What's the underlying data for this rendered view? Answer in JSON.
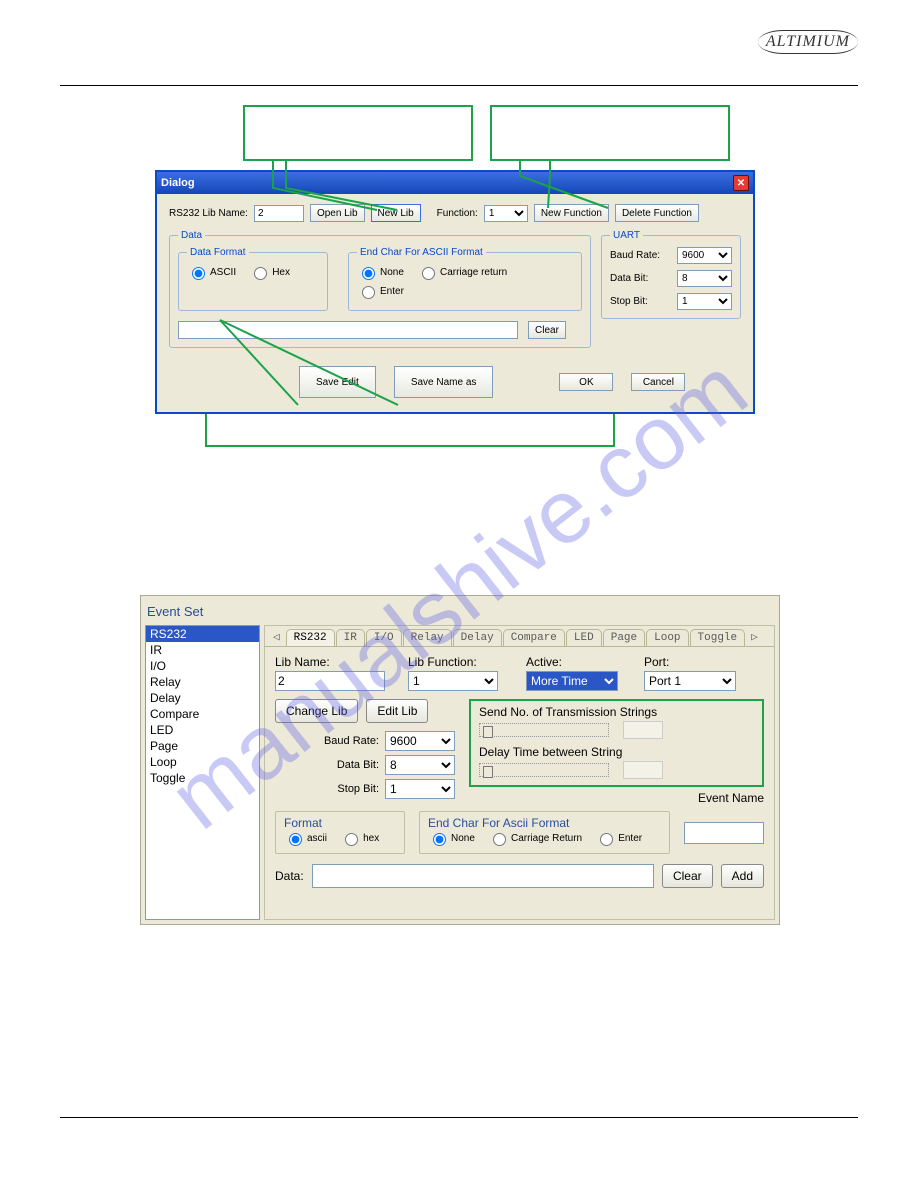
{
  "brand": "ALTIMIUM",
  "watermark": "manualshive.com",
  "dialog": {
    "title": "Dialog",
    "rs232_label": "RS232 Lib Name:",
    "rs232_value": "2",
    "open_lib": "Open Lib",
    "new_lib": "New Lib",
    "function_label": "Function:",
    "function_value": "1",
    "new_function": "New Function",
    "delete_function": "Delete Function",
    "fieldsets": {
      "data": "Data",
      "data_format": "Data Format",
      "end_char": "End Char For ASCII Format",
      "uart": "UART"
    },
    "radios": {
      "ascii": "ASCII",
      "hex": "Hex",
      "none": "None",
      "cr": "Carriage return",
      "enter": "Enter"
    },
    "uart": {
      "baud_label": "Baud Rate:",
      "baud_value": "9600",
      "databit_label": "Data Bit:",
      "databit_value": "8",
      "stopbit_label": "Stop Bit:",
      "stopbit_value": "1"
    },
    "clear": "Clear",
    "save_edit": "Save Edit",
    "save_name_as": "Save Name as",
    "ok": "OK",
    "cancel": "Cancel"
  },
  "eventset": {
    "title": "Event Set",
    "list": [
      "RS232",
      "IR",
      "I/O",
      "Relay",
      "Delay",
      "Compare",
      "LED",
      "Page",
      "Loop",
      "Toggle"
    ],
    "selected": "RS232",
    "tabs": [
      "RS232",
      "IR",
      "I/O",
      "Relay",
      "Delay",
      "Compare",
      "LED",
      "Page",
      "Loop",
      "Toggle"
    ],
    "fields": {
      "lib_name": "Lib Name:",
      "lib_name_value": "2",
      "lib_function": "Lib Function:",
      "lib_function_value": "1",
      "active": "Active:",
      "active_value": "More Time",
      "port": "Port:",
      "port_value": "Port 1",
      "change_lib": "Change Lib",
      "edit_lib": "Edit Lib",
      "send_no": "Send No. of Transmission Strings",
      "delay_time": "Delay Time between String",
      "event_name": "Event Name",
      "baud": "Baud Rate:",
      "baud_value": "9600",
      "databit": "Data Bit:",
      "databit_value": "8",
      "stopbit": "Stop Bit:",
      "stopbit_value": "1",
      "format": "Format",
      "endchar": "End Char For Ascii Format",
      "ascii": "ascii",
      "hex": "hex",
      "none": "None",
      "cr": "Carriage Return",
      "enter": "Enter",
      "data": "Data:",
      "clear": "Clear",
      "add": "Add"
    }
  }
}
